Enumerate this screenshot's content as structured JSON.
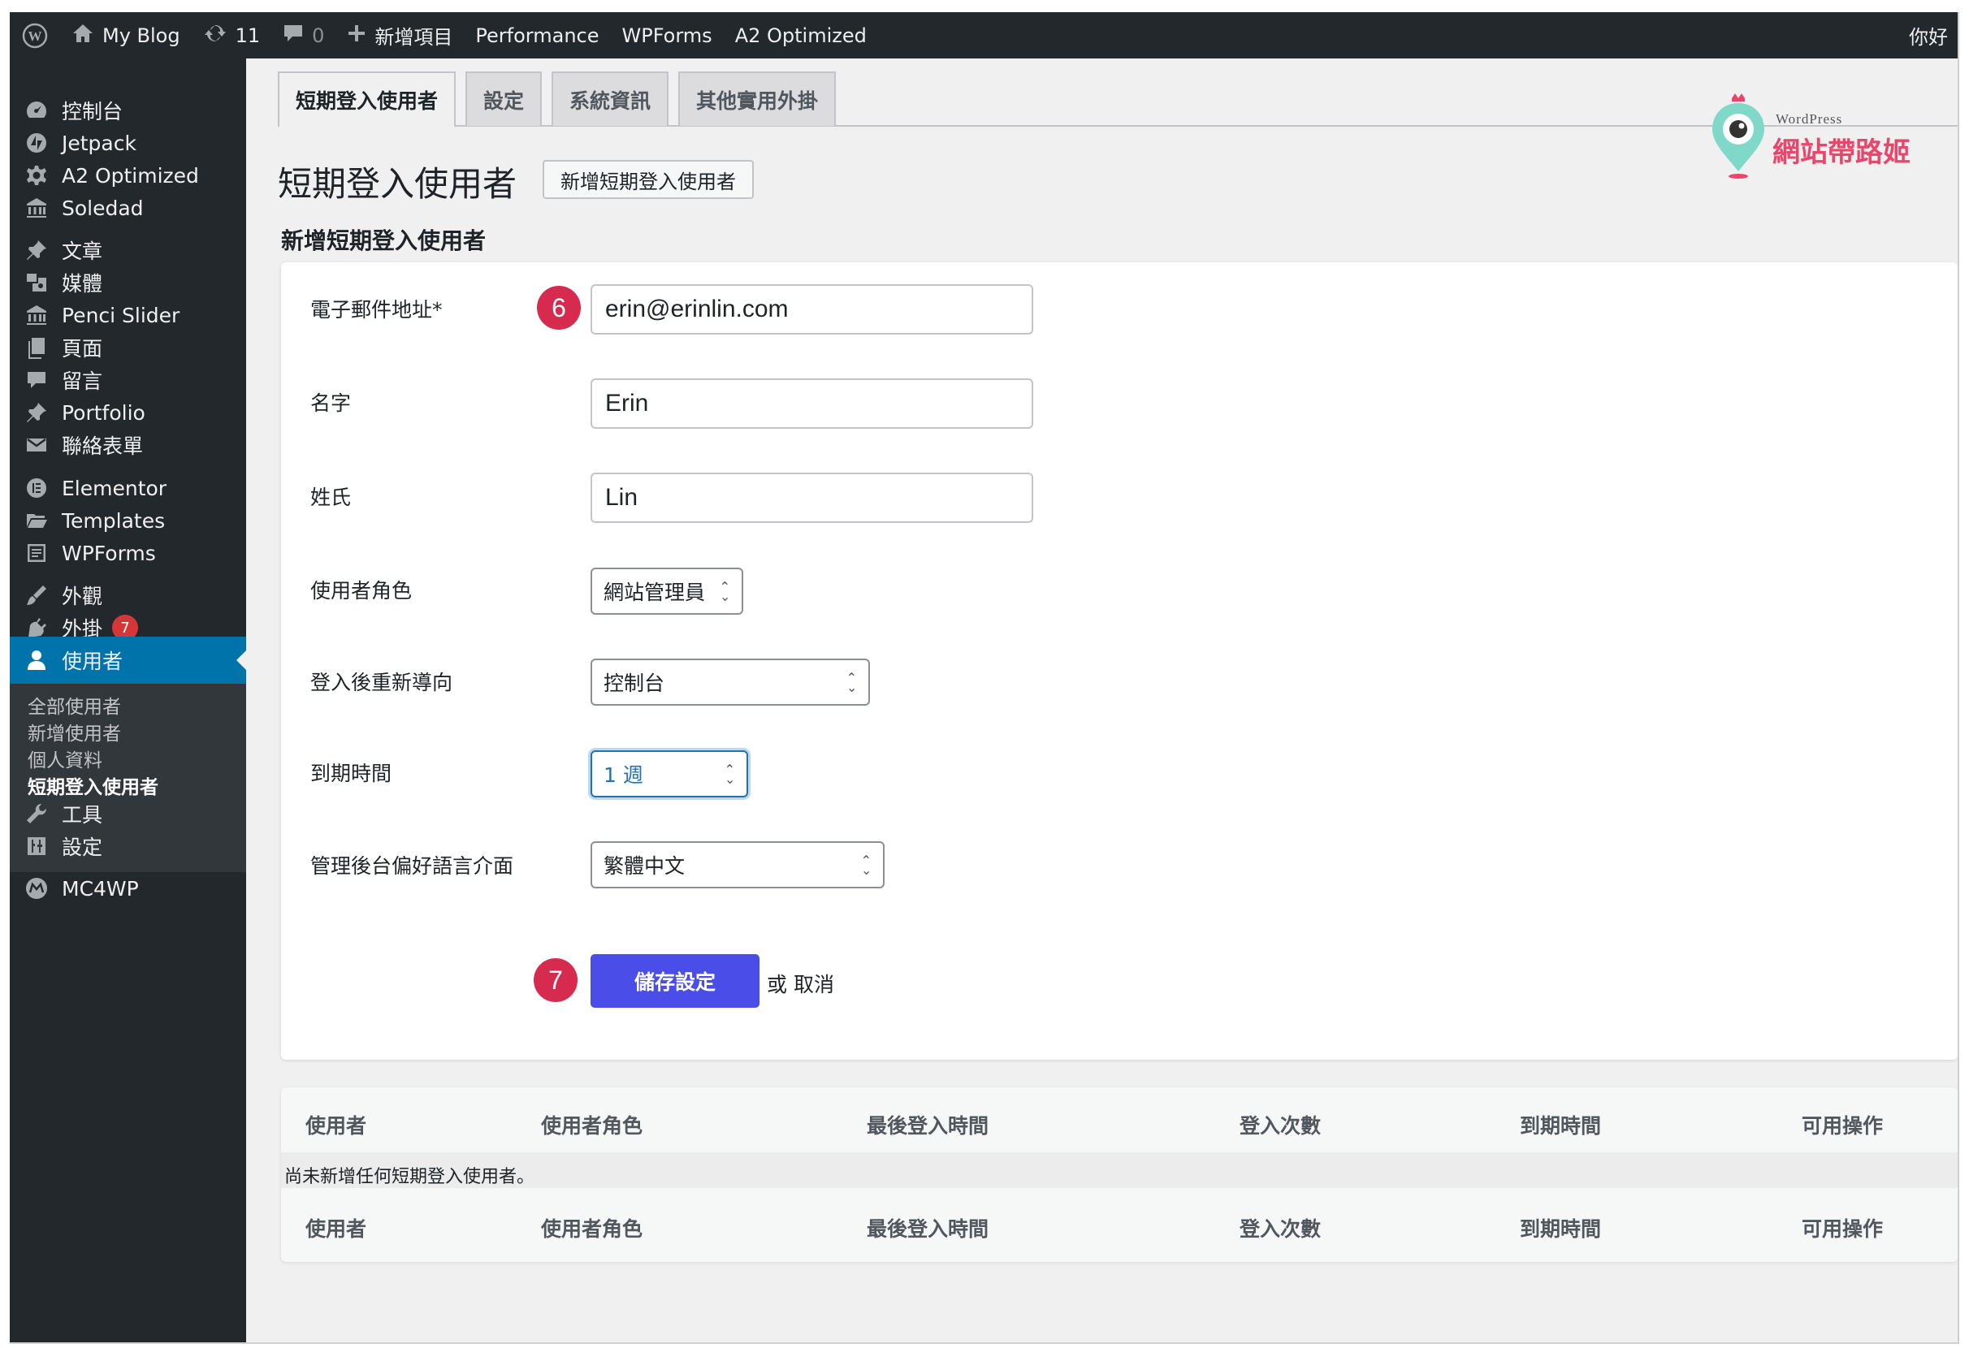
{
  "admin_bar": {
    "site_name": "My Blog",
    "updates_count": "11",
    "comments_count": "0",
    "new_label": "新增項目",
    "items": [
      "Performance",
      "WPForms",
      "A2 Optimized"
    ],
    "greeting": "你好"
  },
  "sidebar": {
    "items": [
      {
        "label": "控制台",
        "icon": "dashboard-icon"
      },
      {
        "label": "Jetpack",
        "icon": "jetpack-icon"
      },
      {
        "label": "A2 Optimized",
        "icon": "gear-icon"
      },
      {
        "label": "Soledad",
        "icon": "bank-icon"
      },
      {
        "label": "文章",
        "icon": "pin-icon"
      },
      {
        "label": "媒體",
        "icon": "media-icon"
      },
      {
        "label": "Penci Slider",
        "icon": "bank-icon"
      },
      {
        "label": "頁面",
        "icon": "pages-icon"
      },
      {
        "label": "留言",
        "icon": "comment-icon"
      },
      {
        "label": "Portfolio",
        "icon": "pin-icon"
      },
      {
        "label": "聯絡表單",
        "icon": "mail-icon"
      },
      {
        "label": "Elementor",
        "icon": "elementor-icon"
      },
      {
        "label": "Templates",
        "icon": "folder-icon"
      },
      {
        "label": "WPForms",
        "icon": "form-icon"
      },
      {
        "label": "外觀",
        "icon": "brush-icon"
      },
      {
        "label": "外掛",
        "icon": "plugin-icon",
        "badge": "7"
      },
      {
        "label": "使用者",
        "icon": "user-icon"
      },
      {
        "label": "工具",
        "icon": "wrench-icon"
      },
      {
        "label": "設定",
        "icon": "settings-icon"
      },
      {
        "label": "MC4WP",
        "icon": "mc4wp-icon"
      }
    ],
    "submenu": [
      "全部使用者",
      "新增使用者",
      "個人資料",
      "短期登入使用者"
    ]
  },
  "tabs": [
    "短期登入使用者",
    "設定",
    "系統資訊",
    "其他實用外掛"
  ],
  "logo": {
    "top": "WordPress",
    "bottom": "網站帶路姬"
  },
  "page": {
    "title": "短期登入使用者",
    "title_button": "新增短期登入使用者",
    "section_title": "新增短期登入使用者"
  },
  "form": {
    "email_label": "電子郵件地址*",
    "email_value": "erin@erinlin.com",
    "first_name_label": "名字",
    "first_name_value": "Erin",
    "last_name_label": "姓氏",
    "last_name_value": "Lin",
    "role_label": "使用者角色",
    "role_value": "網站管理員",
    "redirect_label": "登入後重新導向",
    "redirect_value": "控制台",
    "expiry_label": "到期時間",
    "expiry_value": "1 週",
    "locale_label": "管理後台偏好語言介面",
    "locale_value": "繁體中文",
    "save_label": "儲存設定",
    "or_label": "或",
    "cancel_label": "取消",
    "step_6": "6",
    "step_7": "7"
  },
  "table": {
    "columns": [
      "使用者",
      "使用者角色",
      "最後登入時間",
      "登入次數",
      "到期時間",
      "可用操作"
    ],
    "empty_message": "尚未新增任何短期登入使用者。"
  },
  "colors": {
    "admin_bar": "#23282d",
    "active_menu": "#0073aa",
    "primary_button": "#4a4de8",
    "step_badge": "#d62b4f"
  }
}
